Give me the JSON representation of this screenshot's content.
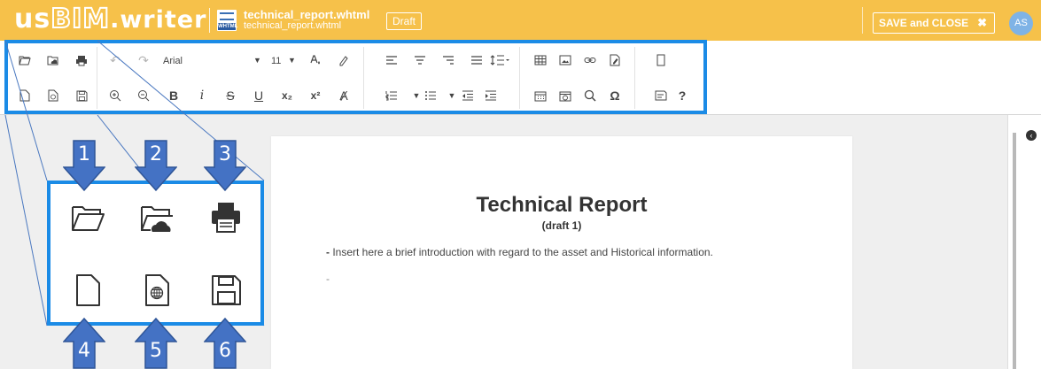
{
  "header": {
    "logo_us": "us",
    "logo_bim": "BIM",
    "logo_writer": ".writer",
    "file_name": "technical_report.whtml",
    "file_sub": "technical_report.whtml",
    "file_tag": "WHTML",
    "status": "Draft",
    "save_close_label": "SAVE and CLOSE",
    "save_close_icon": "✖",
    "avatar_initials": "AS",
    "colors": {
      "header_bg": "#f6c14a",
      "avatar_bg": "#7fb3e6",
      "highlight": "#1b8be6",
      "callout_arrow": "#4472c4"
    }
  },
  "toolbar": {
    "font_name": "Arial",
    "font_size": "11",
    "italic_glyph": "i",
    "bold_glyph": "B",
    "underline_glyph": "U",
    "help_glyph": "?",
    "omega_glyph": "Ω",
    "subscript_glyph": "x₂",
    "superscript_glyph": "x²"
  },
  "document": {
    "title": "Technical Report",
    "subtitle": "(draft 1)",
    "intro_dash": "-",
    "intro_text": " Insert here a brief introduction with regard to the asset and Historical information.",
    "empty_line": "-"
  },
  "callout": {
    "numbers": [
      "1",
      "2",
      "3",
      "4",
      "5",
      "6"
    ],
    "icons": [
      "open-folder-icon",
      "cloud-folder-icon",
      "print-icon",
      "new-document-icon",
      "web-document-icon",
      "save-icon"
    ]
  }
}
